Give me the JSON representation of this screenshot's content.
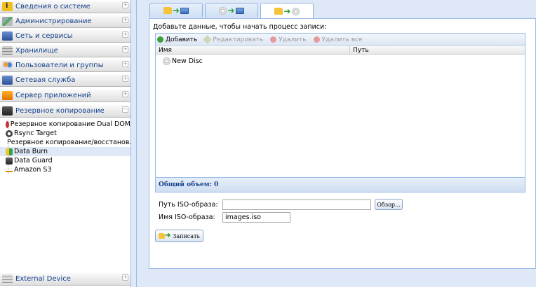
{
  "sidebar": {
    "sections": [
      {
        "label": "Сведения о системе",
        "icon": "info-icon"
      },
      {
        "label": "Администрирование",
        "icon": "tools-icon"
      },
      {
        "label": "Сеть и сервисы",
        "icon": "network-icon"
      },
      {
        "label": "Хранилище",
        "icon": "storage-icon"
      },
      {
        "label": "Пользователи и группы",
        "icon": "users-icon"
      },
      {
        "label": "Сетевая служба",
        "icon": "network-service-icon"
      },
      {
        "label": "Сервер приложений",
        "icon": "app-server-icon"
      },
      {
        "label": "Резервное копирование",
        "icon": "backup-icon"
      }
    ],
    "tree": [
      {
        "label": "Резервное копирование Dual DOM",
        "icon": "dual-dom-icon",
        "color": "#c33"
      },
      {
        "label": "Rsync Target",
        "icon": "rsync-icon",
        "color": "#444"
      },
      {
        "label": "Резервное копирование/восстановление",
        "icon": "restore-icon",
        "color": "#e0a020"
      },
      {
        "label": "Data Burn",
        "icon": "data-burn-icon",
        "color": "#3aa03a"
      },
      {
        "label": "Data Guard",
        "icon": "data-guard-icon",
        "color": "#333"
      },
      {
        "label": "Amazon S3",
        "icon": "amazon-s3-icon",
        "color": "#e08a00"
      }
    ],
    "footer_section": {
      "label": "External Device",
      "icon": "external-device-icon"
    }
  },
  "tabs": [
    {
      "name": "tab-folder-to-iso",
      "icons": [
        "folder-icon",
        "arrow-right-icon",
        "iso-icon"
      ]
    },
    {
      "name": "tab-disc-to-iso",
      "icons": [
        "disc-icon",
        "arrow-right-icon",
        "iso-icon"
      ]
    },
    {
      "name": "tab-folder-to-disc",
      "icons": [
        "folder-icon",
        "arrow-right-icon",
        "disc-icon"
      ]
    }
  ],
  "main": {
    "instruction": "Добавьте данные, чтобы начать процесс записи:",
    "toolbar": {
      "add": "Добавить",
      "edit": "Редактировать",
      "delete": "Удалить",
      "delete_all": "Удалить все"
    },
    "columns": {
      "name": "Имя",
      "path": "Путь"
    },
    "rows": [
      {
        "name": "New Disc"
      }
    ],
    "total_label": "Общий объем: 0",
    "iso_path_label": "Путь ISO-образа:",
    "iso_path_value": "",
    "browse_label": "Обзор...",
    "iso_name_label": "Имя ISO-образа:",
    "iso_name_value": "images.iso",
    "burn_label": "Записать"
  },
  "colors": {
    "accent": "#15428b",
    "panel_bg": "#dfe8f6",
    "border": "#99bbe8",
    "add_green": "#3aa03a"
  }
}
